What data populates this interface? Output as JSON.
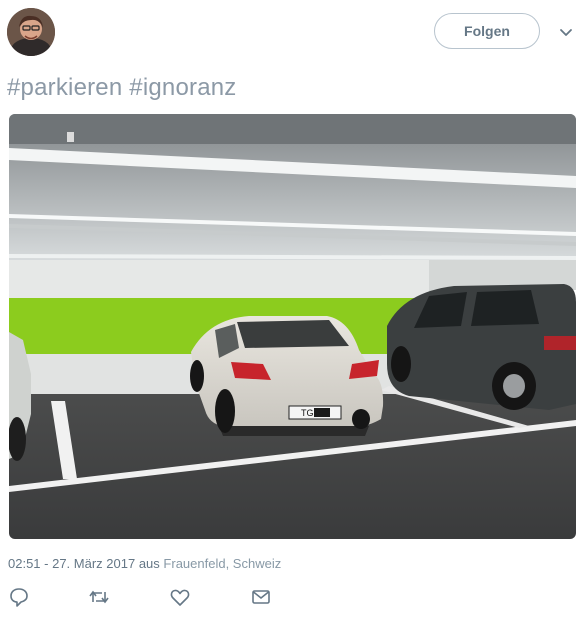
{
  "header": {
    "follow_label": "Folgen",
    "avatar_icon": "user-avatar",
    "more_icon": "chevron-down-icon"
  },
  "tweet": {
    "hashtags": [
      "#parkieren",
      "#ignoranz"
    ],
    "media_description_icon": "photo",
    "timestamp": "02:51 - 27. März 2017",
    "source_prefix": "aus",
    "location": "Frauenfeld, Schweiz",
    "plate_text": "TG"
  },
  "actions": [
    {
      "name": "reply",
      "icon": "reply-icon"
    },
    {
      "name": "retweet",
      "icon": "retweet-icon"
    },
    {
      "name": "like",
      "icon": "heart-icon"
    },
    {
      "name": "message",
      "icon": "mail-icon"
    }
  ],
  "colors": {
    "muted_text": "#657786",
    "hashtag_text": "#8c99a6",
    "border": "#b8c4ce",
    "wall_green": "#8ccc1e"
  }
}
